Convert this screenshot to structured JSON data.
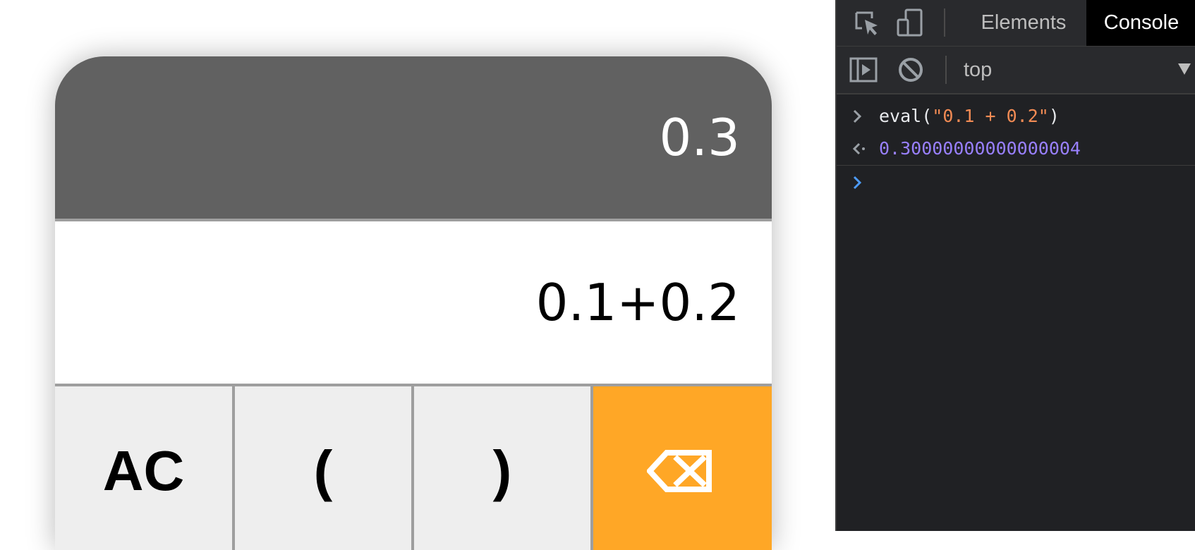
{
  "calculator": {
    "result": "0.3",
    "expression": "0.1+0.2",
    "keys": {
      "ac": "AC",
      "open_paren": "(",
      "close_paren": ")",
      "backspace_icon": "backspace-icon"
    },
    "colors": {
      "result_bg": "#616161",
      "key_bg": "#eeeeee",
      "accent": "#ffa726"
    }
  },
  "devtools": {
    "tabs": {
      "elements": "Elements",
      "console": "Console"
    },
    "context": "top",
    "console": {
      "input_prefix": "eval(",
      "input_string": "\"0.1 + 0.2\"",
      "input_suffix": ")",
      "output": "0.30000000000000004"
    },
    "icons": [
      "inspect-icon",
      "device-toolbar-icon",
      "sidebar-toggle-icon",
      "clear-console-icon",
      "dropdown-arrow-icon"
    ],
    "colors": {
      "bg": "#202124",
      "string": "#f28b54",
      "number": "#9980ff",
      "prompt_active": "#4d9bf5"
    }
  }
}
